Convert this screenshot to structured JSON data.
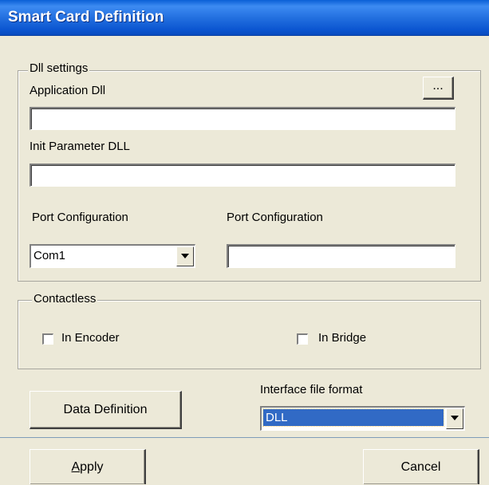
{
  "window": {
    "title": "Smart Card Definition"
  },
  "dll_settings": {
    "group_label": "Dll settings",
    "browse_label": "...",
    "application_dll_label": "Application Dll",
    "application_dll_value": "",
    "init_param_label": "Init Parameter DLL",
    "init_param_value": "",
    "port_config_label": "Port Configuration",
    "port_config_selected": "Com1",
    "port_config2_label": "Port Configuration",
    "port_config2_value": ""
  },
  "contactless": {
    "group_label": "Contactless",
    "in_encoder_label": "In Encoder",
    "in_encoder_checked": false,
    "in_bridge_label": "In Bridge",
    "in_bridge_checked": false
  },
  "footer": {
    "data_definition_label": "Data Definition",
    "interface_format_label": "Interface file format",
    "interface_format_selected": "DLL",
    "apply_label": "Apply",
    "cancel_label": "Cancel"
  }
}
